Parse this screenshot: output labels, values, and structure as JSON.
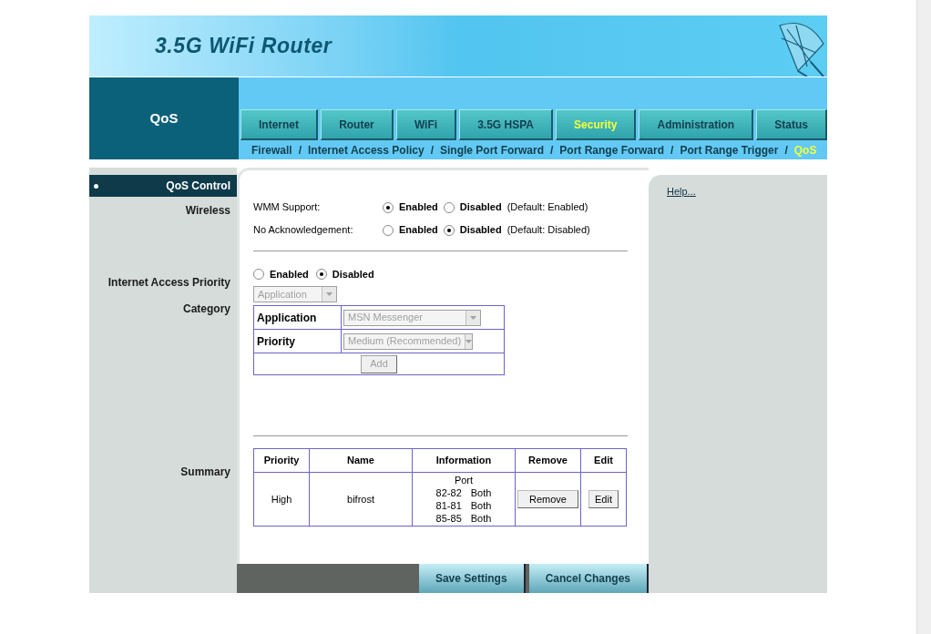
{
  "header": {
    "title": "3.5G WiFi Router"
  },
  "section_title": "QoS",
  "tabs": [
    {
      "label": "Internet",
      "selected": false
    },
    {
      "label": "Router",
      "selected": false
    },
    {
      "label": "WiFi",
      "selected": false
    },
    {
      "label": "3.5G HSPA",
      "selected": false
    },
    {
      "label": "Security",
      "selected": true
    },
    {
      "label": "Administration",
      "selected": false
    },
    {
      "label": "Status",
      "selected": false
    }
  ],
  "subnav": [
    {
      "kind": "link",
      "label": "Firewall",
      "selected": false
    },
    {
      "kind": "separator",
      "label": "/"
    },
    {
      "kind": "link",
      "label": "Internet Access Policy",
      "selected": false
    },
    {
      "kind": "separator",
      "label": "/"
    },
    {
      "kind": "link",
      "label": "Single Port Forward",
      "selected": false
    },
    {
      "kind": "separator",
      "label": "/"
    },
    {
      "kind": "link",
      "label": "Port Range Forward",
      "selected": false
    },
    {
      "kind": "separator",
      "label": "/"
    },
    {
      "kind": "link",
      "label": "Port Range Trigger",
      "selected": false
    },
    {
      "kind": "separator",
      "label": "/"
    },
    {
      "kind": "link",
      "label": "QoS",
      "selected": true
    }
  ],
  "sidebar": {
    "heading": "QoS Control",
    "wireless": "Wireless",
    "priority": "Internet Access Priority",
    "category": "Category",
    "summary": "Summary"
  },
  "wireless_settings": [
    {
      "label": "WMM Support:",
      "options": [
        {
          "label": "Enabled",
          "selected": true
        },
        {
          "label": "Disabled",
          "selected": false
        }
      ],
      "default": "(Default: Enabled)"
    },
    {
      "label": "No Acknowledgement:",
      "options": [
        {
          "label": "Enabled",
          "selected": false
        },
        {
          "label": "Disabled",
          "selected": true
        }
      ],
      "default": "(Default: Disabled)"
    }
  ],
  "internet_access_priority": [
    {
      "label": "Enabled",
      "selected": false
    },
    {
      "label": "Disabled",
      "selected": true
    }
  ],
  "category": {
    "value": "Application",
    "disabled": true
  },
  "rule_form": {
    "application": {
      "label": "Application",
      "value": "MSN Messenger",
      "disabled": true
    },
    "priority": {
      "label": "Priority",
      "value": "Medium (Recommended)",
      "disabled": true
    },
    "add_button": {
      "label": "Add",
      "disabled": true
    }
  },
  "summary": {
    "columns": [
      "Priority",
      "Name",
      "Information",
      "Remove",
      "Edit"
    ],
    "rows": [
      {
        "priority": "High",
        "name": "bifrost",
        "info_title": "Port",
        "ports": [
          {
            "range": "82-82",
            "protocol": "Both"
          },
          {
            "range": "81-81",
            "protocol": "Both"
          },
          {
            "range": "85-85",
            "protocol": "Both"
          }
        ],
        "remove": "Remove",
        "edit": "Edit"
      }
    ]
  },
  "help_link": "Help...",
  "buttons": [
    "Save Settings",
    "Cancel Changes"
  ]
}
